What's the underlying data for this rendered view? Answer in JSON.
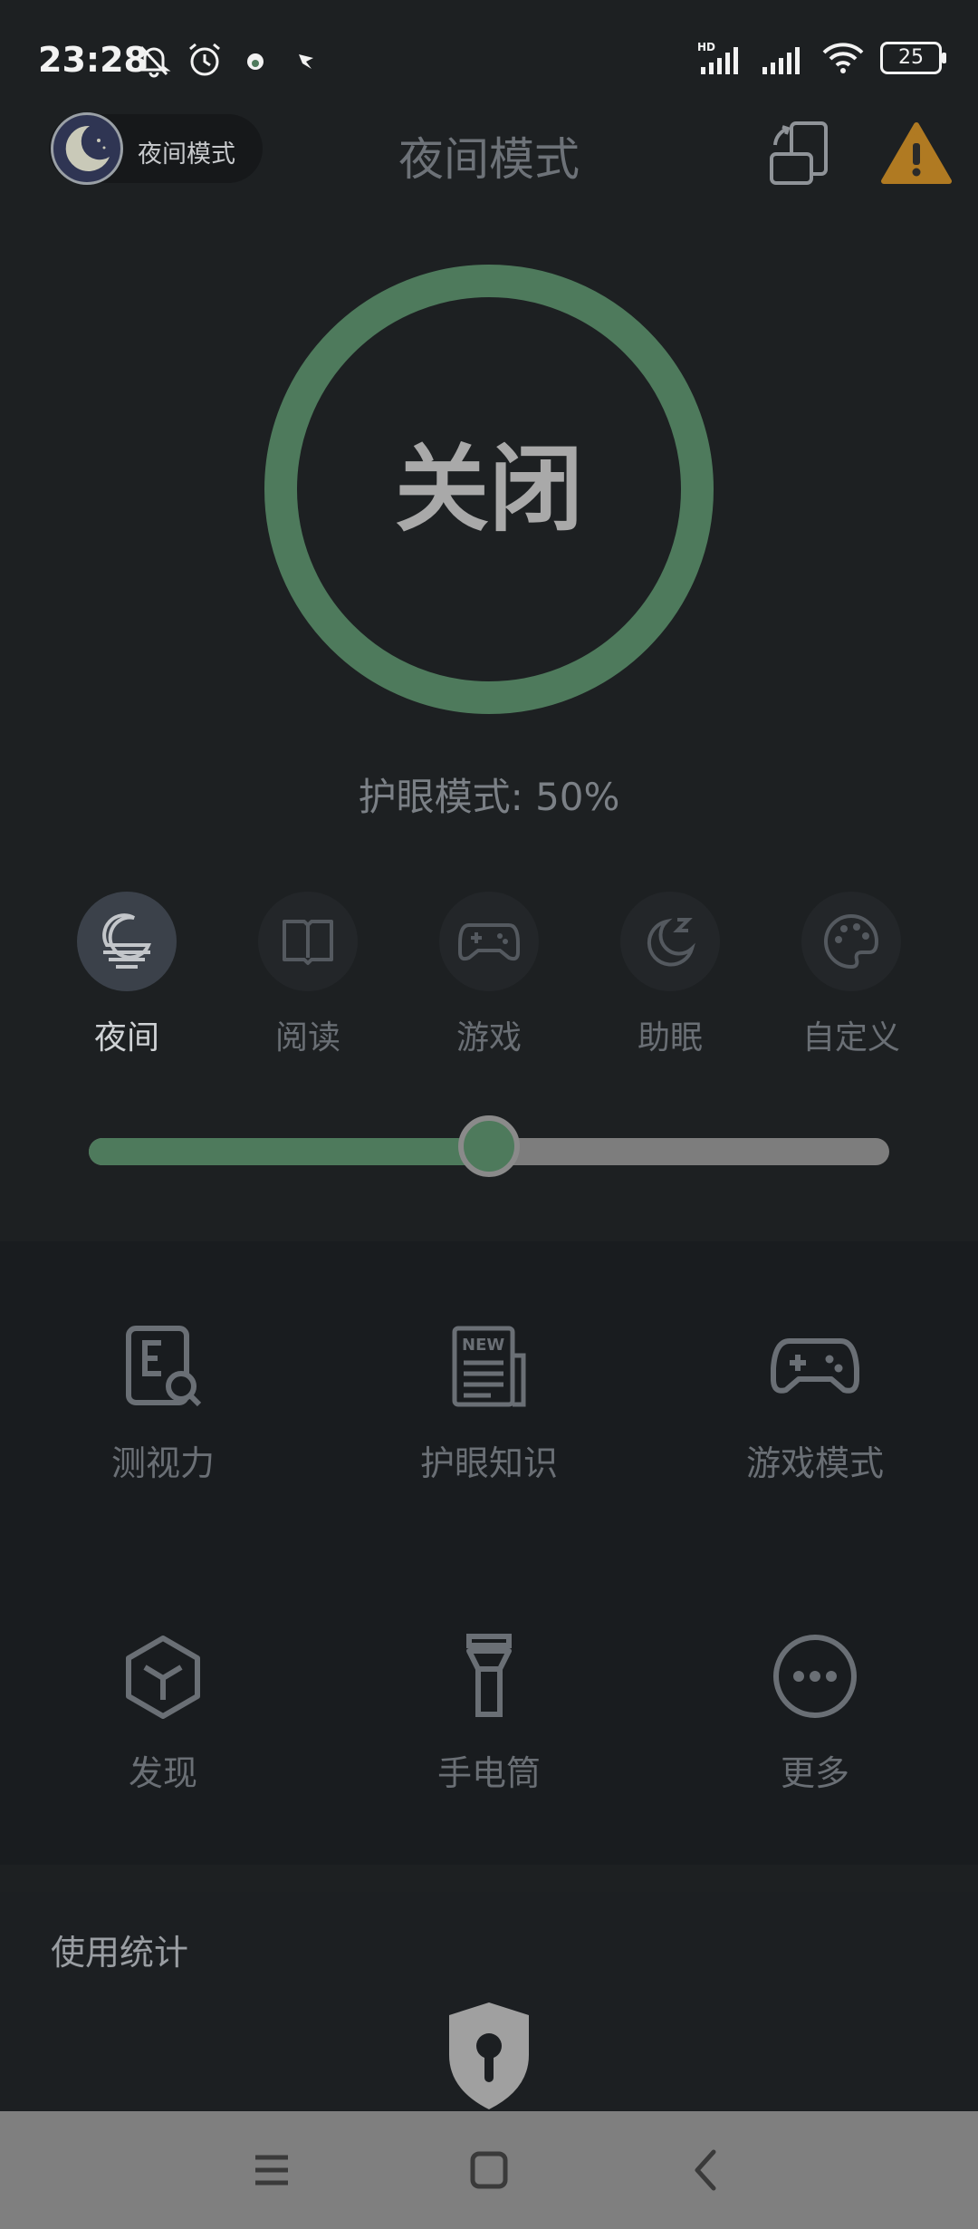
{
  "status_bar": {
    "time": "23:28",
    "battery": "25"
  },
  "header": {
    "pill_label": "夜间模式",
    "title": "夜间模式"
  },
  "main": {
    "toggle_label": "关闭",
    "eye_mode_text": "护眼模式: 50%",
    "slider_value_percent": 50
  },
  "modes": [
    {
      "label": "夜间",
      "icon": "moon-sea-icon",
      "active": true
    },
    {
      "label": "阅读",
      "icon": "book-icon",
      "active": false
    },
    {
      "label": "游戏",
      "icon": "gamepad-icon",
      "active": false
    },
    {
      "label": "助眠",
      "icon": "sleep-moon-icon",
      "active": false
    },
    {
      "label": "自定义",
      "icon": "palette-icon",
      "active": false
    }
  ],
  "tools": [
    {
      "label": "测视力",
      "icon": "vision-test-icon"
    },
    {
      "label": "护眼知识",
      "icon": "news-icon"
    },
    {
      "label": "游戏模式",
      "icon": "gamepad-icon"
    },
    {
      "label": "发现",
      "icon": "cube-icon"
    },
    {
      "label": "手电筒",
      "icon": "flashlight-icon"
    },
    {
      "label": "更多",
      "icon": "more-icon"
    }
  ],
  "stats": {
    "title": "使用统计"
  },
  "colors": {
    "accent": "#4e7a5c",
    "warning": "#b07a22",
    "background": "#1d2022"
  }
}
